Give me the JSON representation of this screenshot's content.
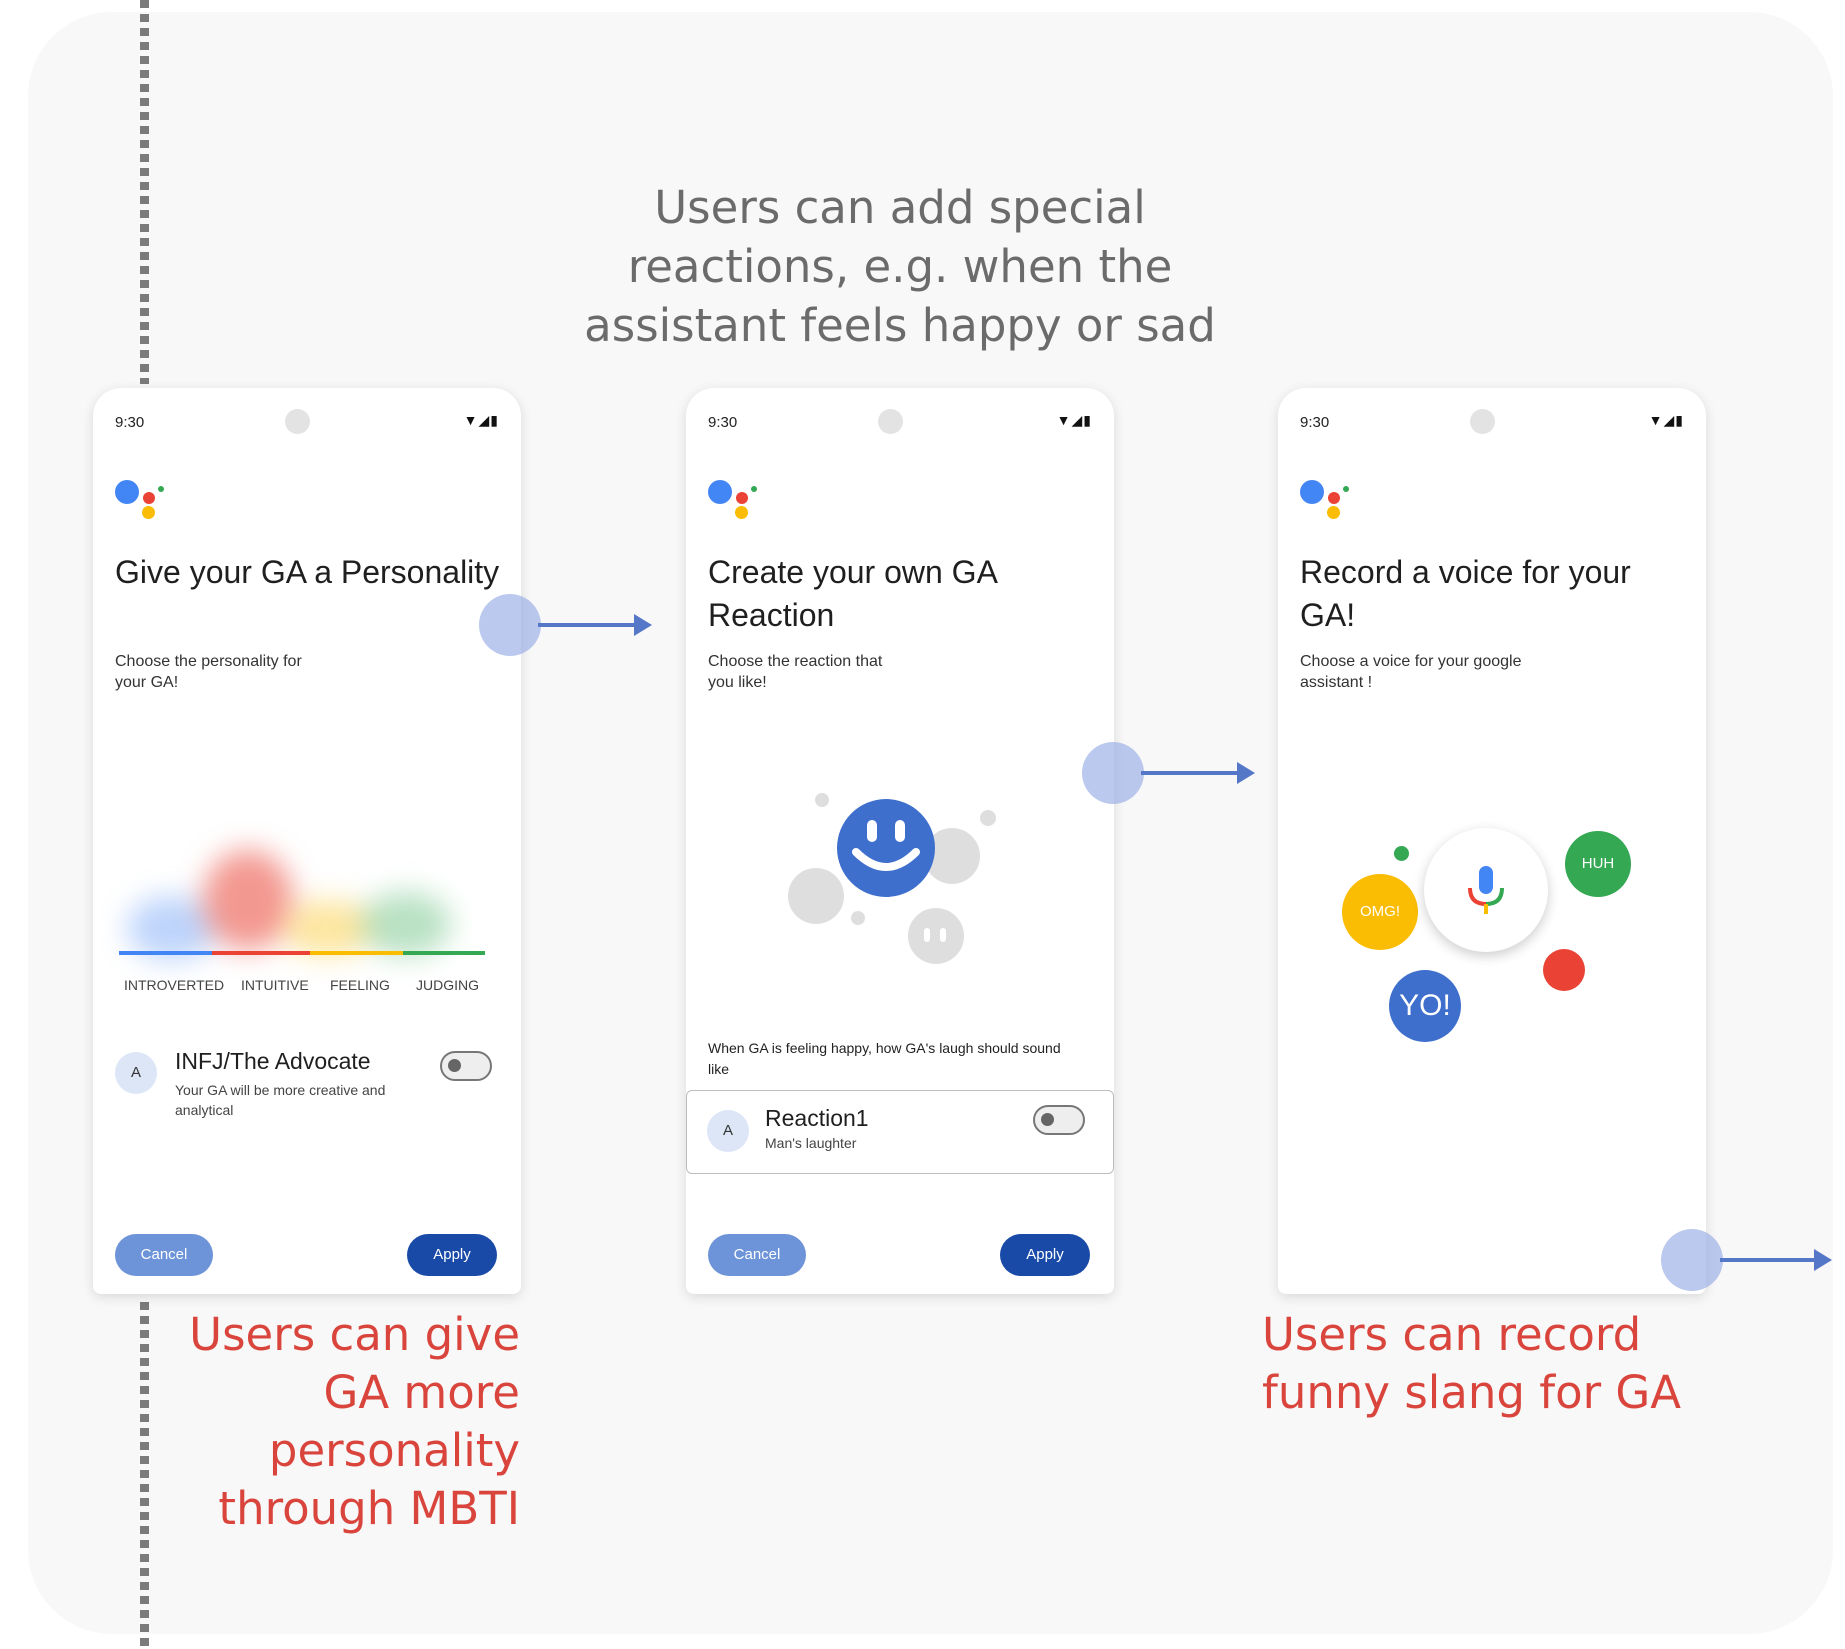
{
  "captions": {
    "top": "Users can add special reactions, e.g. when the assistant feels happy or sad",
    "left": "Users can give GA more personality through MBTI",
    "right": "Users can record funny slang for GA"
  },
  "colors": {
    "ga_blue": "#4285f4",
    "ga_red": "#ea4335",
    "ga_yellow": "#fbbc04",
    "ga_green": "#34a853",
    "caption_red": "#d9453c",
    "button_primary": "#1a4aa8",
    "button_secondary": "#6d93d8",
    "flow_arrow": "#5577c7"
  },
  "screens": [
    {
      "status_time": "9:30",
      "status_icons": "▼◢▮",
      "title": "Give your GA a Personality",
      "subtitle": "Choose the personality for your GA!",
      "traits": [
        "INTROVERTED",
        "INTUITIVE",
        "FEELING",
        "JUDGING"
      ],
      "item": {
        "avatar": "A",
        "title": "INFJ/The Advocate",
        "description": "Your GA will be more creative and analytical",
        "toggle_on": false
      },
      "cancel_label": "Cancel",
      "apply_label": "Apply"
    },
    {
      "status_time": "9:30",
      "status_icons": "▼◢▮",
      "title": "Create your own GA Reaction",
      "subtitle": "Choose the reaction that you like!",
      "description": "When GA is feeling happy, how GA's laugh should sound like",
      "item": {
        "avatar": "A",
        "title": "Reaction1",
        "description": "Man's laughter",
        "toggle_on": false
      },
      "cancel_label": "Cancel",
      "apply_label": "Apply"
    },
    {
      "status_time": "9:30",
      "status_icons": "▼◢▮",
      "title": "Record a voice for your GA!",
      "subtitle": "Choose a voice for your google assistant !",
      "bubbles": [
        "OMG!",
        "HUH",
        "YO!"
      ],
      "mic_icon": "microphone-icon"
    }
  ]
}
